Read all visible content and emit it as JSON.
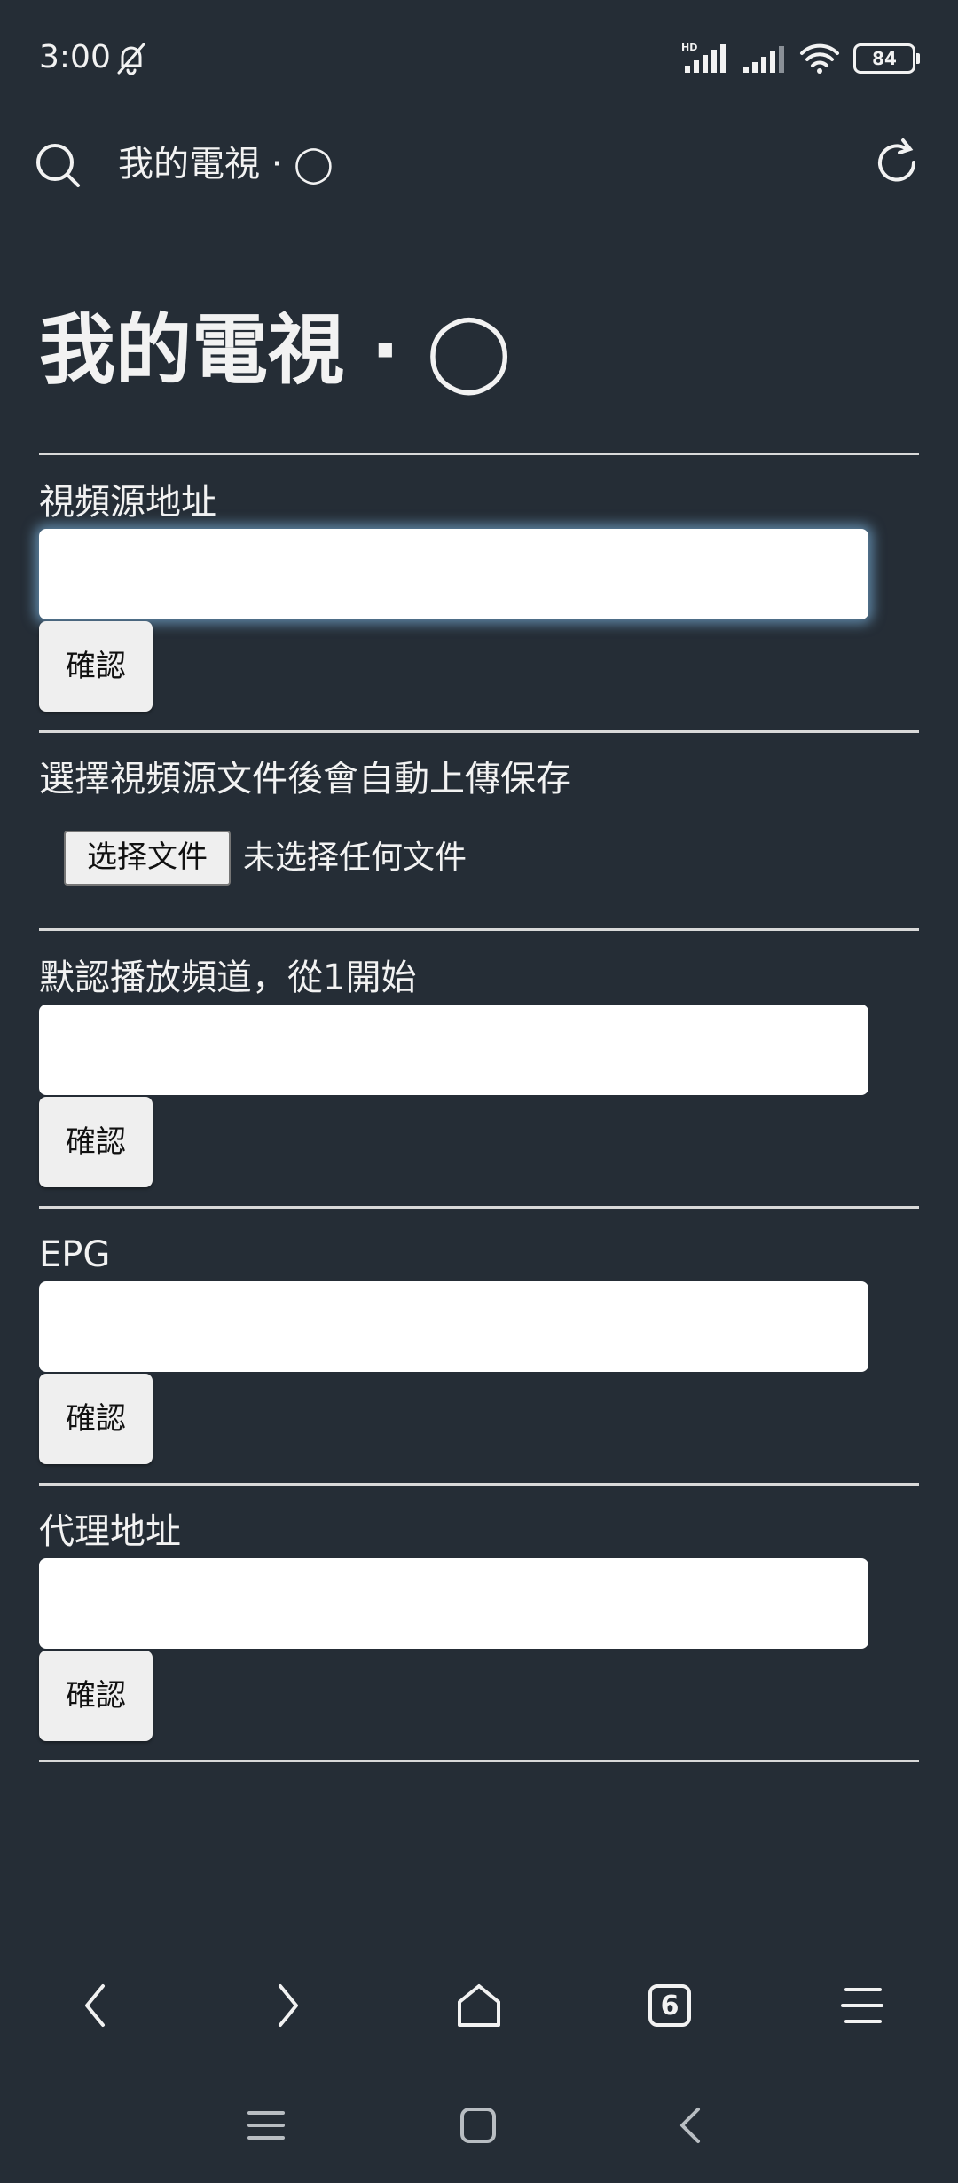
{
  "status_bar": {
    "time": "3:00",
    "network_label": "HD",
    "battery": "84"
  },
  "browser": {
    "tab_title": "我的電視 · ◯"
  },
  "page": {
    "title": "我的電視 · ◯",
    "sections": [
      {
        "label": "視頻源地址",
        "value": "",
        "button": "確認"
      },
      {
        "label": "選擇視頻源文件後會自動上傳保存",
        "file_button": "选择文件",
        "file_status": "未选择任何文件"
      },
      {
        "label": "默認播放頻道，從1開始",
        "value": "",
        "button": "確認"
      },
      {
        "label": "EPG",
        "value": "",
        "button": "確認"
      },
      {
        "label": "代理地址",
        "value": "",
        "button": "確認"
      }
    ]
  },
  "bottom_nav": {
    "tabs_count": "6"
  },
  "colors": {
    "background": "#252d36",
    "text": "#f2f2f2",
    "input": "#ffffff",
    "button": "#efefef"
  }
}
